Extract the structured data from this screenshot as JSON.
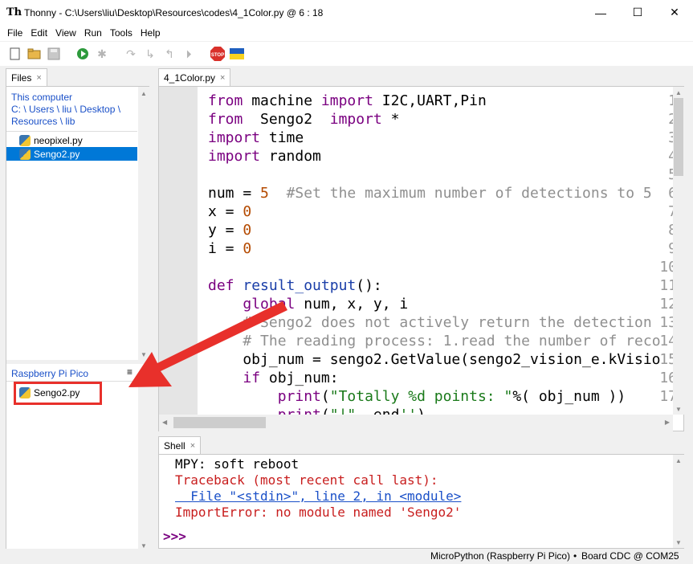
{
  "window": {
    "title": "Thonny  -  C:\\Users\\liu\\Desktop\\Resources\\codes\\4_1Color.py  @  6 : 18",
    "minimize": "—",
    "maximize": "☐",
    "close": "✕"
  },
  "menu": [
    "File",
    "Edit",
    "View",
    "Run",
    "Tools",
    "Help"
  ],
  "toolbar": {
    "new_icon": "📄",
    "open_icon": "📂",
    "save_icon": "💾",
    "run_icon": "▶",
    "debug_icon": "✱",
    "step_over_icon": "↷",
    "step_into_icon": "↳",
    "step_out_icon": "↰",
    "resume_icon": "⏵",
    "stop_label": "STOP"
  },
  "files_panel": {
    "tab_label": "Files",
    "close": "×",
    "computer_heading": "This computer",
    "path": [
      "C: \\ Users \\ liu \\ Desktop \\",
      "Resources \\ lib"
    ],
    "files": [
      "neopixel.py",
      "Sengo2.py"
    ],
    "selected_index": 1,
    "device_heading": "Raspberry Pi Pico",
    "menu_icon": "≡",
    "device_files": [
      "Sengo2.py"
    ]
  },
  "editor": {
    "tab_label": "4_1Color.py",
    "close": "×",
    "line_numbers": [
      "1",
      "2",
      "3",
      "4",
      "5",
      "6",
      "7",
      "8",
      "9",
      "10",
      "11",
      "12",
      "13",
      "14",
      "15",
      "16",
      "17",
      "18"
    ]
  },
  "shell": {
    "tab_label": "Shell",
    "close": "×",
    "line1": "MPY: soft reboot",
    "line2": "Traceback (most recent call last):",
    "line3": "  File \"<stdin>\", line 2, in <module>",
    "line4": "ImportError: no module named 'Sengo2'",
    "prompt": ">>>"
  },
  "status": {
    "interpreter": "MicroPython (Raspberry Pi Pico)",
    "separator": "•",
    "port": "Board CDC @ COM25"
  },
  "colors": {
    "accent": "#0078d7",
    "annotation_red": "#e8302b",
    "keyword": "#7a0080",
    "number": "#b44a00",
    "error": "#c81e1e"
  }
}
